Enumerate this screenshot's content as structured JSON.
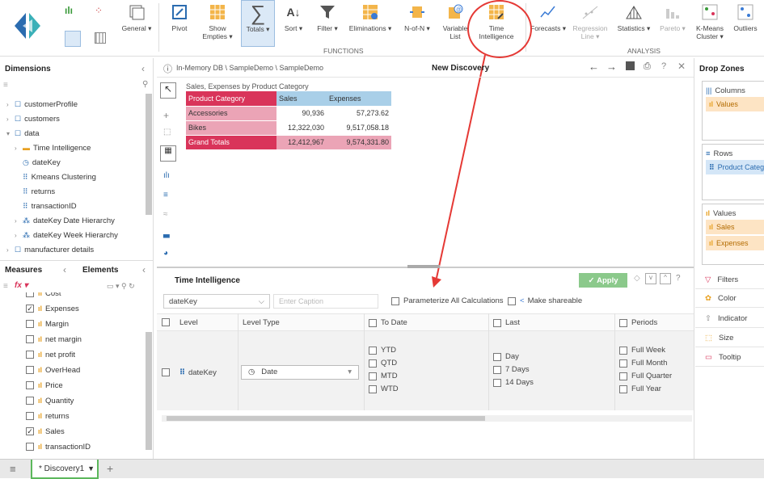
{
  "ribbon": {
    "general_label": "General ▾",
    "pivot_label": "Pivot",
    "show_empties_label": "Show\nEmpties ▾",
    "totals_label": "Totals ▾",
    "sort_label": "Sort ▾",
    "filter_label": "Filter ▾",
    "eliminations_label": "Eliminations ▾",
    "nofn_label": "N-of-N ▾",
    "variable_list_label": "Variable\nList",
    "time_intelligence_label": "Time\nIntelligence",
    "functions_group": "FUNCTIONS",
    "forecasts_label": "Forecasts ▾",
    "regression_label": "Regression\nLine ▾",
    "statistics_label": "Statistics ▾",
    "pareto_label": "Pareto ▾",
    "kmeans_label": "K-Means\nCluster ▾",
    "outliers_label": "Outliers",
    "analysis_group": "ANALYSIS"
  },
  "dimensions": {
    "title": "Dimensions",
    "items": [
      {
        "label": "customerProfile"
      },
      {
        "label": "customers"
      },
      {
        "label": "data"
      },
      {
        "label": "Time Intelligence"
      },
      {
        "label": "dateKey"
      },
      {
        "label": "Kmeans Clustering"
      },
      {
        "label": "returns"
      },
      {
        "label": "transactionID"
      },
      {
        "label": "dateKey Date Hierarchy"
      },
      {
        "label": "dateKey Week Hierarchy"
      },
      {
        "label": "manufacturer details"
      }
    ]
  },
  "measures": {
    "tab_measures": "Measures",
    "tab_elements": "Elements",
    "items": [
      {
        "label": "Cost",
        "checked": false
      },
      {
        "label": "Expenses",
        "checked": true
      },
      {
        "label": "Margin",
        "checked": false
      },
      {
        "label": "net margin",
        "checked": false
      },
      {
        "label": "net profit",
        "checked": false
      },
      {
        "label": "OverHead",
        "checked": false
      },
      {
        "label": "Price",
        "checked": false
      },
      {
        "label": "Quantity",
        "checked": false
      },
      {
        "label": "returns",
        "checked": false
      },
      {
        "label": "Sales",
        "checked": true
      },
      {
        "label": "transactionID",
        "checked": false
      }
    ]
  },
  "breadcrumb": "In-Memory DB \\ SampleDemo \\ SampleDemo",
  "discovery_title": "New Discovery",
  "grid": {
    "caption": "Sales, Expenses by Product Category",
    "headers": [
      "Product Category",
      "Sales",
      "Expenses"
    ],
    "rows": [
      [
        "Accessories",
        "90,936",
        "57,273.62"
      ],
      [
        "Bikes",
        "12,322,030",
        "9,517,058.18"
      ],
      [
        "Grand Totals",
        "12,412,967",
        "9,574,331.80"
      ]
    ]
  },
  "time_intel": {
    "title": "Time Intelligence",
    "apply_label": "Apply",
    "datekey_value": "dateKey",
    "caption_placeholder": "Enter Caption",
    "parameterize_label": "Parameterize All Calculations",
    "shareable_label": "Make shareable",
    "col_level": "Level",
    "col_level_type": "Level Type",
    "col_to_date": "To Date",
    "col_last": "Last",
    "col_periods": "Periods",
    "row_level": "dateKey",
    "row_level_type": "Date",
    "to_date_options": [
      "YTD",
      "QTD",
      "MTD",
      "WTD"
    ],
    "last_options": [
      "Day",
      "7 Days",
      "14 Days"
    ],
    "period_options": [
      "Full Week",
      "Full Month",
      "Full Quarter",
      "Full Year"
    ]
  },
  "drop_zones": {
    "title": "Drop Zones",
    "columns_label": "Columns",
    "columns_items": [
      "Values"
    ],
    "rows_label": "Rows",
    "rows_items": [
      "Product Category"
    ],
    "values_label": "Values",
    "values_items": [
      "Sales",
      "Expenses"
    ],
    "filters_label": "Filters",
    "color_label": "Color",
    "indicator_label": "Indicator",
    "size_label": "Size",
    "tooltip_label": "Tooltip"
  },
  "tab": {
    "label": "* Discovery1"
  },
  "colors": {
    "accent_red": "#d9345a",
    "light_red": "#eba4b6",
    "header_blue": "#a9cfe8",
    "green_border": "#5cb85c",
    "annotation_red": "#e53935"
  }
}
